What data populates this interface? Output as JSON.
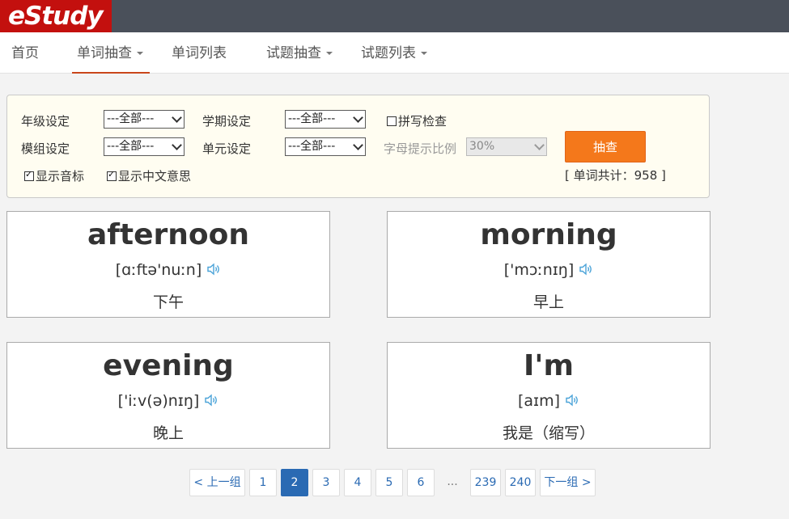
{
  "app": {
    "logo": "eStudy"
  },
  "nav": {
    "items": [
      {
        "label": "首页",
        "dropdown": false,
        "active": false
      },
      {
        "label": "单词抽查",
        "dropdown": true,
        "active": true
      },
      {
        "label": "单词列表",
        "dropdown": false,
        "active": false
      },
      {
        "label": "试题抽查",
        "dropdown": true,
        "active": false
      },
      {
        "label": "试题列表",
        "dropdown": true,
        "active": false
      }
    ]
  },
  "filters": {
    "grade_label": "年级设定",
    "grade_value": "---全部---",
    "term_label": "学期设定",
    "term_value": "---全部---",
    "spell_check_label": "拼写检查",
    "spell_check_checked": false,
    "module_label": "模组设定",
    "module_value": "---全部---",
    "unit_label": "单元设定",
    "unit_value": "---全部---",
    "hint_ratio_label": "字母提示比例",
    "hint_ratio_value": "30%",
    "show_phonetic_label": "显示音标",
    "show_phonetic_checked": true,
    "show_meaning_label": "显示中文意思",
    "show_meaning_checked": true,
    "query_button": "抽查",
    "word_count_text": "[ 单词共计：958 ]"
  },
  "cards": [
    {
      "word": "afternoon",
      "phonetic": "[ɑːftə'nuːn]",
      "meaning": "下午",
      "icon": "speaker-icon"
    },
    {
      "word": "morning",
      "phonetic": "['mɔːnɪŋ]",
      "meaning": "早上",
      "icon": "speaker-icon"
    },
    {
      "word": "evening",
      "phonetic": "['iːv(ə)nɪŋ]",
      "meaning": "晚上",
      "icon": "speaker-icon"
    },
    {
      "word": "I'm",
      "phonetic": "[aɪm]",
      "meaning": "我是（缩写）",
      "icon": "speaker-icon"
    }
  ],
  "pagination": {
    "prev": "< 上一组",
    "pages": [
      "1",
      "2",
      "3",
      "4",
      "5",
      "6",
      "...",
      "239",
      "240"
    ],
    "current": "2",
    "next": "下一组 >"
  },
  "colors": {
    "topbar": "#4a505a",
    "logo_bg": "#c3100e",
    "accent_underline": "#c9461b",
    "query_button": "#f4781b",
    "page_active": "#2a6ab3",
    "speaker_icon": "#4aa3d8"
  }
}
